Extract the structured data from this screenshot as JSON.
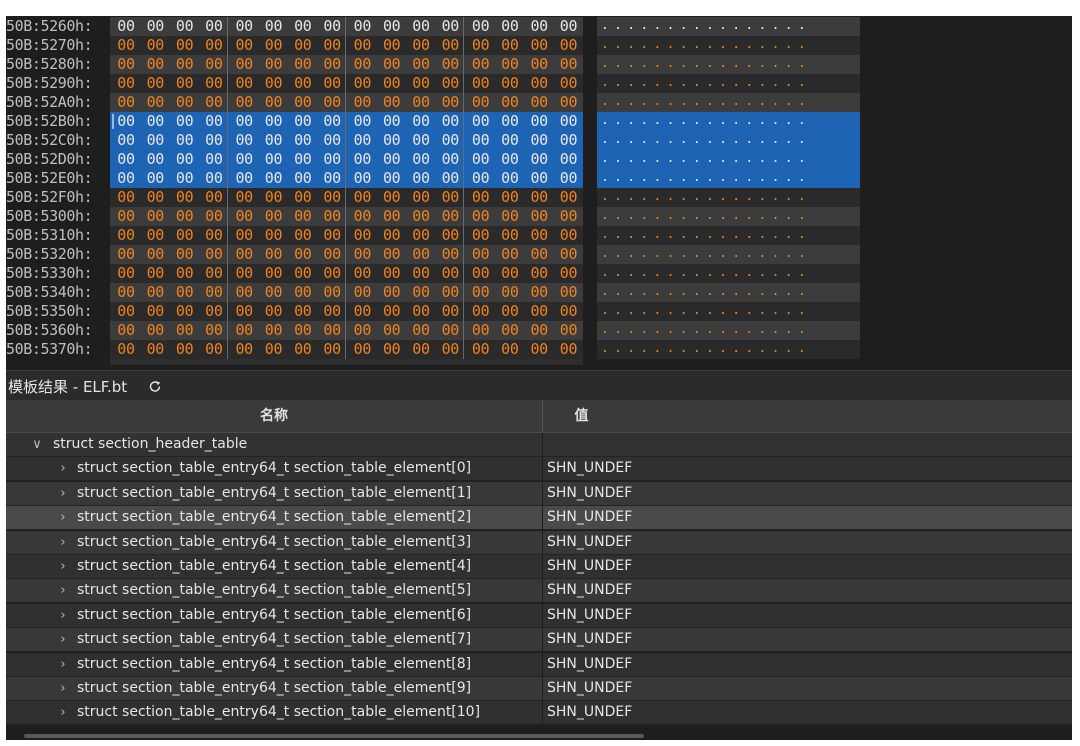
{
  "hex": {
    "rows": [
      {
        "addr": "50B:5260h:",
        "bytes": [
          "00",
          "00",
          "00",
          "00",
          "00",
          "00",
          "00",
          "00",
          "00",
          "00",
          "00",
          "00",
          "00",
          "00",
          "00",
          "00"
        ],
        "ascii": "................"
      },
      {
        "addr": "50B:5270h:",
        "bytes": [
          "00",
          "00",
          "00",
          "00",
          "00",
          "00",
          "00",
          "00",
          "00",
          "00",
          "00",
          "00",
          "00",
          "00",
          "00",
          "00"
        ],
        "ascii": "................"
      },
      {
        "addr": "50B:5280h:",
        "bytes": [
          "00",
          "00",
          "00",
          "00",
          "00",
          "00",
          "00",
          "00",
          "00",
          "00",
          "00",
          "00",
          "00",
          "00",
          "00",
          "00"
        ],
        "ascii": "................"
      },
      {
        "addr": "50B:5290h:",
        "bytes": [
          "00",
          "00",
          "00",
          "00",
          "00",
          "00",
          "00",
          "00",
          "00",
          "00",
          "00",
          "00",
          "00",
          "00",
          "00",
          "00"
        ],
        "ascii": "................"
      },
      {
        "addr": "50B:52A0h:",
        "bytes": [
          "00",
          "00",
          "00",
          "00",
          "00",
          "00",
          "00",
          "00",
          "00",
          "00",
          "00",
          "00",
          "00",
          "00",
          "00",
          "00"
        ],
        "ascii": "................"
      },
      {
        "addr": "50B:52B0h:",
        "bytes": [
          "00",
          "00",
          "00",
          "00",
          "00",
          "00",
          "00",
          "00",
          "00",
          "00",
          "00",
          "00",
          "00",
          "00",
          "00",
          "00"
        ],
        "ascii": "................"
      },
      {
        "addr": "50B:52C0h:",
        "bytes": [
          "00",
          "00",
          "00",
          "00",
          "00",
          "00",
          "00",
          "00",
          "00",
          "00",
          "00",
          "00",
          "00",
          "00",
          "00",
          "00"
        ],
        "ascii": "................"
      },
      {
        "addr": "50B:52D0h:",
        "bytes": [
          "00",
          "00",
          "00",
          "00",
          "00",
          "00",
          "00",
          "00",
          "00",
          "00",
          "00",
          "00",
          "00",
          "00",
          "00",
          "00"
        ],
        "ascii": "................"
      },
      {
        "addr": "50B:52E0h:",
        "bytes": [
          "00",
          "00",
          "00",
          "00",
          "00",
          "00",
          "00",
          "00",
          "00",
          "00",
          "00",
          "00",
          "00",
          "00",
          "00",
          "00"
        ],
        "ascii": "................"
      },
      {
        "addr": "50B:52F0h:",
        "bytes": [
          "00",
          "00",
          "00",
          "00",
          "00",
          "00",
          "00",
          "00",
          "00",
          "00",
          "00",
          "00",
          "00",
          "00",
          "00",
          "00"
        ],
        "ascii": "................"
      },
      {
        "addr": "50B:5300h:",
        "bytes": [
          "00",
          "00",
          "00",
          "00",
          "00",
          "00",
          "00",
          "00",
          "00",
          "00",
          "00",
          "00",
          "00",
          "00",
          "00",
          "00"
        ],
        "ascii": "................"
      },
      {
        "addr": "50B:5310h:",
        "bytes": [
          "00",
          "00",
          "00",
          "00",
          "00",
          "00",
          "00",
          "00",
          "00",
          "00",
          "00",
          "00",
          "00",
          "00",
          "00",
          "00"
        ],
        "ascii": "................"
      },
      {
        "addr": "50B:5320h:",
        "bytes": [
          "00",
          "00",
          "00",
          "00",
          "00",
          "00",
          "00",
          "00",
          "00",
          "00",
          "00",
          "00",
          "00",
          "00",
          "00",
          "00"
        ],
        "ascii": "................"
      },
      {
        "addr": "50B:5330h:",
        "bytes": [
          "00",
          "00",
          "00",
          "00",
          "00",
          "00",
          "00",
          "00",
          "00",
          "00",
          "00",
          "00",
          "00",
          "00",
          "00",
          "00"
        ],
        "ascii": "................"
      },
      {
        "addr": "50B:5340h:",
        "bytes": [
          "00",
          "00",
          "00",
          "00",
          "00",
          "00",
          "00",
          "00",
          "00",
          "00",
          "00",
          "00",
          "00",
          "00",
          "00",
          "00"
        ],
        "ascii": "................"
      },
      {
        "addr": "50B:5350h:",
        "bytes": [
          "00",
          "00",
          "00",
          "00",
          "00",
          "00",
          "00",
          "00",
          "00",
          "00",
          "00",
          "00",
          "00",
          "00",
          "00",
          "00"
        ],
        "ascii": "................"
      },
      {
        "addr": "50B:5360h:",
        "bytes": [
          "00",
          "00",
          "00",
          "00",
          "00",
          "00",
          "00",
          "00",
          "00",
          "00",
          "00",
          "00",
          "00",
          "00",
          "00",
          "00"
        ],
        "ascii": "................"
      },
      {
        "addr": "50B:5370h:",
        "bytes": [
          "00",
          "00",
          "00",
          "00",
          "00",
          "00",
          "00",
          "00",
          "00",
          "00",
          "00",
          "00",
          "00",
          "00",
          "00",
          "00"
        ],
        "ascii": "................"
      }
    ],
    "selected_rows": [
      "50B:52B0h:",
      "50B:52C0h:",
      "50B:52D0h:",
      "50B:52E0h:"
    ],
    "colors": {
      "byte_text": "#f0821e",
      "selection": "#1e64b4",
      "address_text": "#bfbfbf"
    }
  },
  "template_panel": {
    "title": "模板结果 - ELF.bt",
    "refresh_icon": "refresh-icon",
    "columns": {
      "name": "名称",
      "value": "值"
    },
    "root": {
      "label": "struct section_header_table",
      "expanded": true
    },
    "rows": [
      {
        "label": "struct section_table_entry64_t section_table_element[0]",
        "value": "SHN_UNDEF"
      },
      {
        "label": "struct section_table_entry64_t section_table_element[1]",
        "value": "SHN_UNDEF"
      },
      {
        "label": "struct section_table_entry64_t section_table_element[2]",
        "value": "SHN_UNDEF"
      },
      {
        "label": "struct section_table_entry64_t section_table_element[3]",
        "value": "SHN_UNDEF"
      },
      {
        "label": "struct section_table_entry64_t section_table_element[4]",
        "value": "SHN_UNDEF"
      },
      {
        "label": "struct section_table_entry64_t section_table_element[5]",
        "value": "SHN_UNDEF"
      },
      {
        "label": "struct section_table_entry64_t section_table_element[6]",
        "value": "SHN_UNDEF"
      },
      {
        "label": "struct section_table_entry64_t section_table_element[7]",
        "value": "SHN_UNDEF"
      },
      {
        "label": "struct section_table_entry64_t section_table_element[8]",
        "value": "SHN_UNDEF"
      },
      {
        "label": "struct section_table_entry64_t section_table_element[9]",
        "value": "SHN_UNDEF"
      },
      {
        "label": "struct section_table_entry64_t section_table_element[10]",
        "value": "SHN_UNDEF"
      }
    ],
    "highlighted_row": "struct section_table_entry64_t section_table_element[2]"
  }
}
